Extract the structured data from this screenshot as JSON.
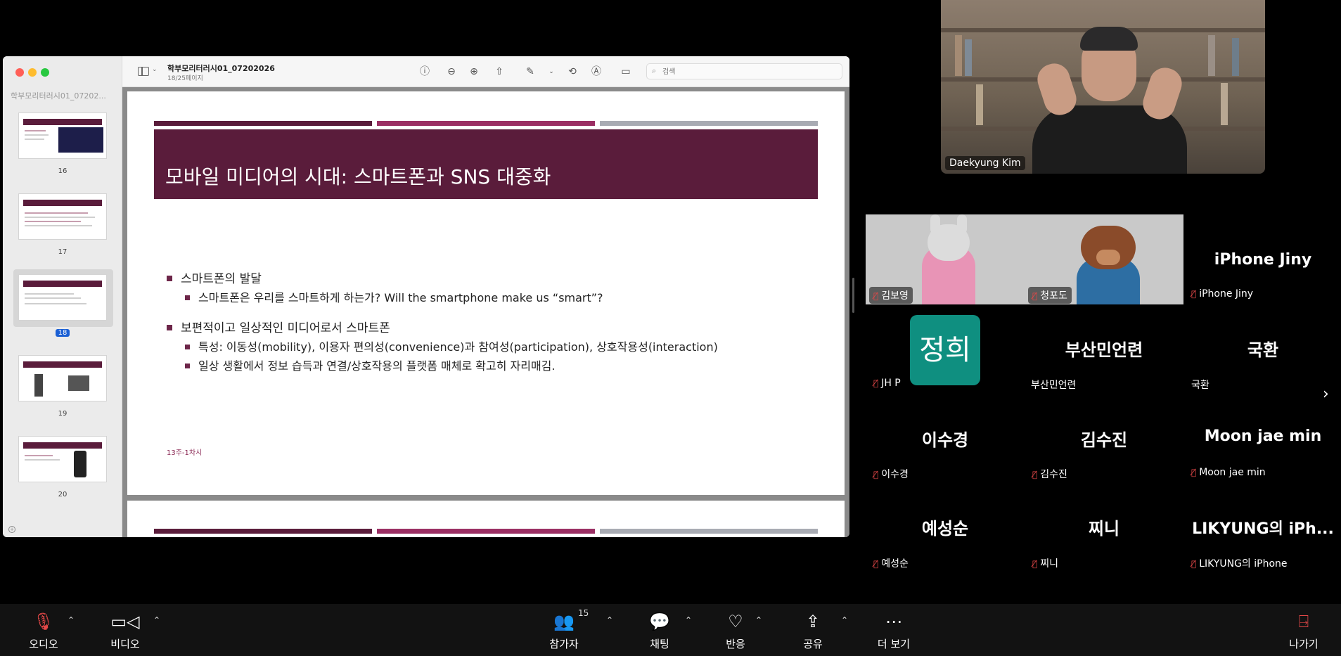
{
  "viewer": {
    "sidebar_doc_name": "학부모리터러시01_07202...",
    "doc_title": "학부모리터러시01_07202026",
    "doc_subtitle": "18/25페이지",
    "search_placeholder": "검색",
    "pages": [
      {
        "number": "16"
      },
      {
        "number": "17"
      },
      {
        "number": "18",
        "selected": true
      },
      {
        "number": "19"
      },
      {
        "number": "20"
      }
    ]
  },
  "slide": {
    "title": "모바일  미디어의 시대: 스마트폰과 SNS 대중화",
    "bullets": [
      "스마트폰의 발달",
      "스마트폰은 우리를 스마트하게 하는가? Will the smartphone make us “smart”?",
      "보편적이고 일상적인 미디어로서 스마트폰",
      "특성: 이동성(mobility), 이용자 편의성(convenience)과 참여성(participation), 상호작용성(interaction)",
      "일상 생활에서 정보 습득과 연결/상호작용의 플랫폼 매체로 확고히 자리매김."
    ],
    "footer": "13주-1차시",
    "colors": {
      "primary": "#5a1c3b",
      "secondary": "#9b2f64",
      "gray": "#a8abb3"
    }
  },
  "speaker": {
    "name": "Daekyung Kim"
  },
  "participants": [
    {
      "display": "",
      "tag": "김보영",
      "avatar": "rabbit"
    },
    {
      "display": "",
      "tag": "청포도",
      "avatar": "bear"
    },
    {
      "display": "iPhone Jiny",
      "tag": "iPhone Jiny"
    },
    {
      "display": "정희",
      "tag": "JH P",
      "avatar": "teal-square"
    },
    {
      "display": "부산민언련",
      "tag": "부산민언련"
    },
    {
      "display": "국환",
      "tag": "국환"
    },
    {
      "display": "이수경",
      "tag": "이수경"
    },
    {
      "display": "김수진",
      "tag": "김수진"
    },
    {
      "display": "Moon  jae min",
      "tag": "Moon  jae min"
    },
    {
      "display": "예성순",
      "tag": "예성순"
    },
    {
      "display": "찌니",
      "tag": "찌니"
    },
    {
      "display": "LIKYUNG의 iPh...",
      "tag": "LIKYUNG의 iPhone"
    }
  ],
  "controls": {
    "audio": "오디오",
    "video": "비디오",
    "participants": "참가자",
    "participant_count": "15",
    "chat": "채팅",
    "reactions": "반응",
    "share": "공유",
    "more": "더 보기",
    "leave": "나가기"
  },
  "icons": [
    "microphone-muted-icon",
    "camera-icon",
    "people-icon",
    "chat-bubble-icon",
    "heart-icon",
    "share-up-arrow-icon",
    "more-dots-icon",
    "leave-door-icon",
    "chevron-right-icon"
  ]
}
